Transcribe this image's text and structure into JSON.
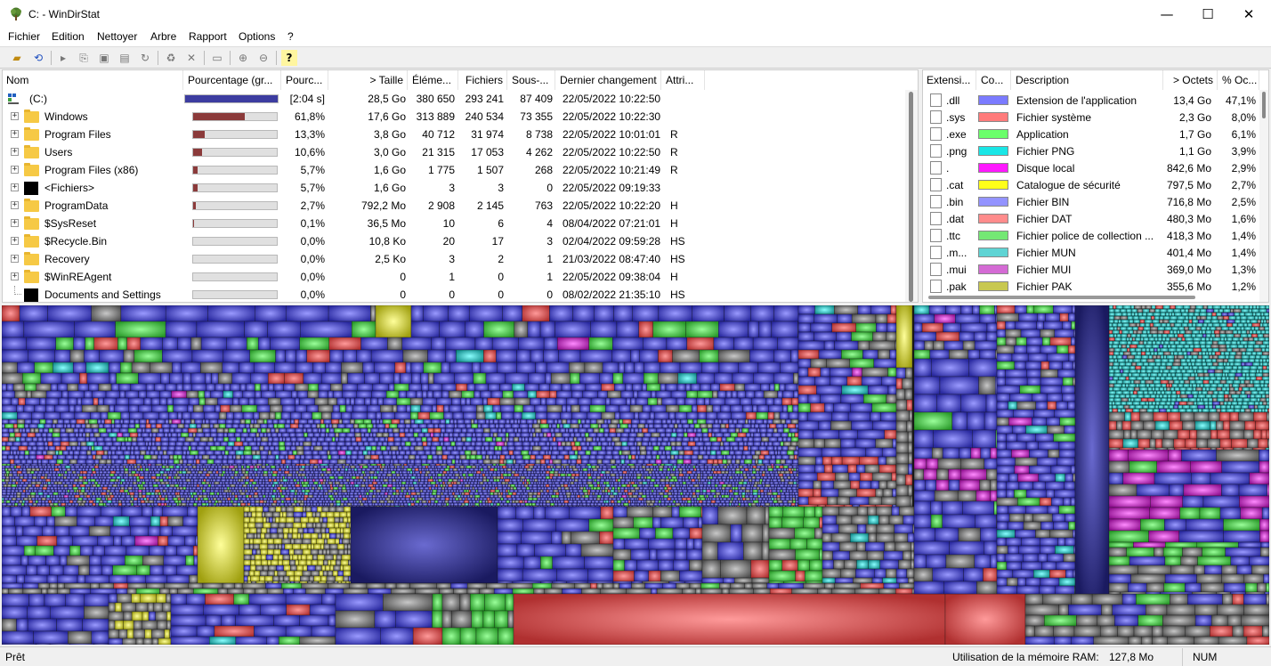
{
  "window": {
    "title": "C: - WinDirStat",
    "minimize_glyph": "—",
    "maximize_glyph": "☐",
    "close_glyph": "✕"
  },
  "menu": [
    "Fichier",
    "Edition",
    "Nettoyer",
    "Arbre",
    "Rapport",
    "Options",
    "?"
  ],
  "toolbar_icons": [
    "open-icon",
    "refresh-icon",
    "play-icon",
    "copy-path-icon",
    "explorer-icon",
    "command-prompt-icon",
    "refresh-selected-icon",
    "recycle-bin-icon",
    "delete-icon",
    "new-folder-icon",
    "zoom-in-icon",
    "zoom-out-icon",
    "help-icon"
  ],
  "tree": {
    "columns": [
      "Nom",
      "Pourcentage (gr...",
      "Pourc...",
      "> Taille",
      "Éléme...",
      "Fichiers",
      "Sous-...",
      "Dernier changement",
      "Attri..."
    ],
    "root": {
      "name": "(C:)",
      "bar": 1.0,
      "pct": "[2:04 s]",
      "size": "28,5 Go",
      "items": "380 650",
      "files": "293 241",
      "subdirs": "87 409",
      "changed": "22/05/2022  10:22:50",
      "attr": ""
    },
    "rows": [
      {
        "name": "Windows",
        "icon": "folder",
        "bar": 0.618,
        "pct": "61,8%",
        "size": "17,6 Go",
        "items": "313 889",
        "files": "240 534",
        "subdirs": "73 355",
        "changed": "22/05/2022  10:22:30",
        "attr": ""
      },
      {
        "name": "Program Files",
        "icon": "folder",
        "bar": 0.133,
        "pct": "13,3%",
        "size": "3,8 Go",
        "items": "40 712",
        "files": "31 974",
        "subdirs": "8 738",
        "changed": "22/05/2022  10:01:01",
        "attr": "R"
      },
      {
        "name": "Users",
        "icon": "folder",
        "bar": 0.106,
        "pct": "10,6%",
        "size": "3,0 Go",
        "items": "21 315",
        "files": "17 053",
        "subdirs": "4 262",
        "changed": "22/05/2022  10:22:50",
        "attr": "R"
      },
      {
        "name": "Program Files (x86)",
        "icon": "folder",
        "bar": 0.057,
        "pct": "5,7%",
        "size": "1,6 Go",
        "items": "1 775",
        "files": "1 507",
        "subdirs": "268",
        "changed": "22/05/2022  10:21:49",
        "attr": "R"
      },
      {
        "name": "<Fichiers>",
        "icon": "files",
        "bar": 0.057,
        "pct": "5,7%",
        "size": "1,6 Go",
        "items": "3",
        "files": "3",
        "subdirs": "0",
        "changed": "22/05/2022  09:19:33",
        "attr": ""
      },
      {
        "name": "ProgramData",
        "icon": "folder",
        "bar": 0.027,
        "pct": "2,7%",
        "size": "792,2 Mo",
        "items": "2 908",
        "files": "2 145",
        "subdirs": "763",
        "changed": "22/05/2022  10:22:20",
        "attr": "H"
      },
      {
        "name": "$SysReset",
        "icon": "folder",
        "bar": 0.001,
        "pct": "0,1%",
        "size": "36,5 Mo",
        "items": "10",
        "files": "6",
        "subdirs": "4",
        "changed": "08/04/2022  07:21:01",
        "attr": "H"
      },
      {
        "name": "$Recycle.Bin",
        "icon": "folder",
        "bar": 0.0,
        "pct": "0,0%",
        "size": "10,8 Ko",
        "items": "20",
        "files": "17",
        "subdirs": "3",
        "changed": "02/04/2022  09:59:28",
        "attr": "HS"
      },
      {
        "name": "Recovery",
        "icon": "folder",
        "bar": 0.0,
        "pct": "0,0%",
        "size": "2,5 Ko",
        "items": "3",
        "files": "2",
        "subdirs": "1",
        "changed": "21/03/2022  08:47:40",
        "attr": "HS"
      },
      {
        "name": "$WinREAgent",
        "icon": "folder",
        "bar": 0.0,
        "pct": "0,0%",
        "size": "0",
        "items": "1",
        "files": "0",
        "subdirs": "1",
        "changed": "22/05/2022  09:38:04",
        "attr": "H"
      },
      {
        "name": "Documents and Settings",
        "icon": "link",
        "bar": 0.0,
        "pct": "0,0%",
        "size": "0",
        "items": "0",
        "files": "0",
        "subdirs": "0",
        "changed": "08/02/2022  21:35:10",
        "attr": "HS"
      }
    ]
  },
  "extensions": {
    "columns": [
      "Extensi...",
      "Co...",
      "Description",
      "> Octets",
      "% Oc..."
    ],
    "rows": [
      {
        "ext": ".dll",
        "color": "#7b7bff",
        "desc": "Extension de l'application",
        "bytes": "13,4 Go",
        "pct": "47,1%"
      },
      {
        "ext": ".sys",
        "color": "#ff7b7b",
        "desc": "Fichier système",
        "bytes": "2,3 Go",
        "pct": "8,0%"
      },
      {
        "ext": ".exe",
        "color": "#6bff6b",
        "desc": "Application",
        "bytes": "1,7 Go",
        "pct": "6,1%"
      },
      {
        "ext": ".png",
        "color": "#19e6e6",
        "desc": "Fichier PNG",
        "bytes": "1,1 Go",
        "pct": "3,9%"
      },
      {
        "ext": ".",
        "color": "#ff19ff",
        "desc": "Disque local",
        "bytes": "842,6 Mo",
        "pct": "2,9%"
      },
      {
        "ext": ".cat",
        "color": "#ffff19",
        "desc": "Catalogue de sécurité",
        "bytes": "797,5 Mo",
        "pct": "2,7%"
      },
      {
        "ext": ".bin",
        "color": "#9393ff",
        "desc": "Fichier BIN",
        "bytes": "716,8 Mo",
        "pct": "2,5%"
      },
      {
        "ext": ".dat",
        "color": "#ff8c8c",
        "desc": "Fichier DAT",
        "bytes": "480,3 Mo",
        "pct": "1,6%"
      },
      {
        "ext": ".ttc",
        "color": "#74e874",
        "desc": "Fichier police de collection ...",
        "bytes": "418,3 Mo",
        "pct": "1,4%"
      },
      {
        "ext": ".m...",
        "color": "#5fd4d4",
        "desc": "Fichier MUN",
        "bytes": "401,4 Mo",
        "pct": "1,4%"
      },
      {
        "ext": ".mui",
        "color": "#d46bd4",
        "desc": "Fichier MUI",
        "bytes": "369,0 Mo",
        "pct": "1,3%"
      },
      {
        "ext": ".pak",
        "color": "#c8c850",
        "desc": "Fichier PAK",
        "bytes": "355,6 Mo",
        "pct": "1,2%"
      }
    ]
  },
  "status": {
    "left": "Prêt",
    "ram_label": "Utilisation de la mémoire RAM:",
    "ram_value": "127,8 Mo",
    "num": "NUM"
  },
  "colors": {
    "dll": "#4a4ae0",
    "sys": "#e05050",
    "exe": "#50d050",
    "png": "#20c8c8",
    "local": "#d020d0",
    "cat": "#e0e020",
    "grey": "#7a7a7a",
    "bar_root": "#3c3ca0",
    "bar_dir": "#8b3a3a"
  }
}
